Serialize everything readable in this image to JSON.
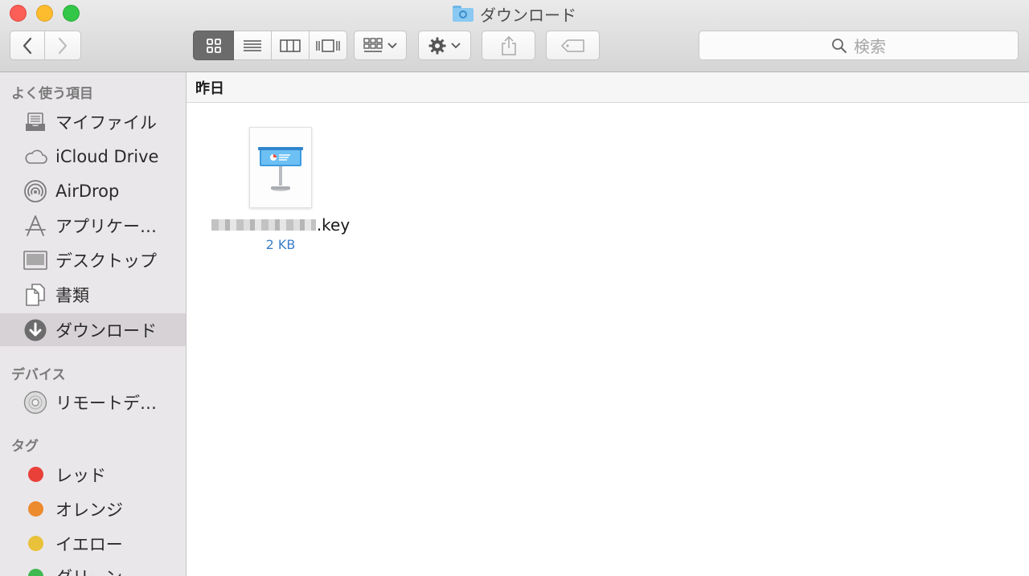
{
  "window": {
    "title": "ダウンロード"
  },
  "toolbar": {
    "search_placeholder": "検索"
  },
  "sidebar": {
    "favorites_header": "よく使う項目",
    "favorites": [
      {
        "label": "マイファイル",
        "icon": "all-my-files-icon"
      },
      {
        "label": "iCloud Drive",
        "icon": "cloud-icon"
      },
      {
        "label": "AirDrop",
        "icon": "airdrop-icon"
      },
      {
        "label": "アプリケー…",
        "icon": "applications-icon"
      },
      {
        "label": "デスクトップ",
        "icon": "desktop-icon"
      },
      {
        "label": "書類",
        "icon": "documents-icon"
      },
      {
        "label": "ダウンロード",
        "icon": "downloads-icon",
        "selected": true
      }
    ],
    "devices_header": "デバイス",
    "devices": [
      {
        "label": "リモートデ…",
        "icon": "remote-disc-icon"
      }
    ],
    "tags_header": "タグ",
    "tags": [
      {
        "label": "レッド",
        "color": "#e9403a"
      },
      {
        "label": "オレンジ",
        "color": "#ec8a2e"
      },
      {
        "label": "イエロー",
        "color": "#e9c13a"
      },
      {
        "label": "グリーン",
        "color": "#3fb950"
      }
    ]
  },
  "content": {
    "group_header": "昨日",
    "files": [
      {
        "name_suffix": ".key",
        "size": "2 KB",
        "icon": "keynote-file-icon"
      }
    ]
  }
}
